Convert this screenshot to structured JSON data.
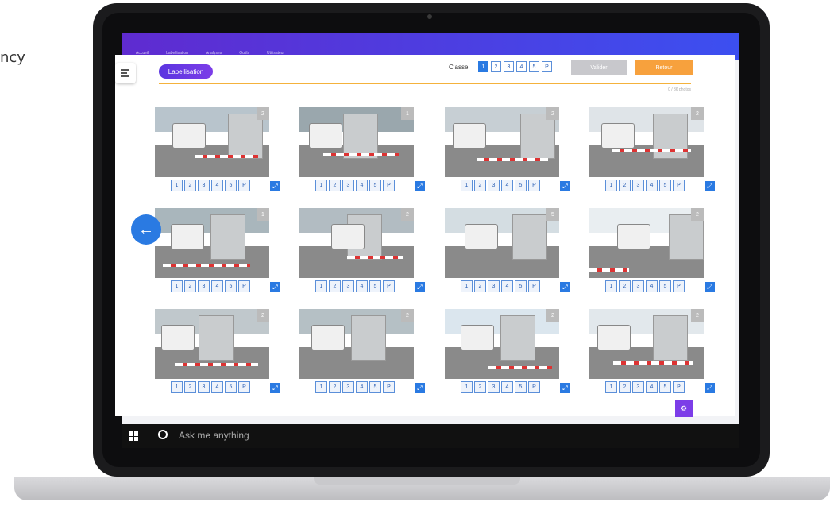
{
  "background_text": "ncy",
  "top_nav": [
    "Accueil",
    "Labellisation",
    "Analyses",
    "Outils",
    "Utilisateur"
  ],
  "taskbar": {
    "search_placeholder": "Ask me anything"
  },
  "app": {
    "title": "Labellisation",
    "classe_label": "Classe:",
    "classe_options": [
      "1",
      "2",
      "3",
      "4",
      "5",
      "P"
    ],
    "classe_selected": "1",
    "valider_label": "Valider",
    "retour_label": "Retour",
    "counter": "0 / 36 photos"
  },
  "photo_class_options": [
    "1",
    "2",
    "3",
    "4",
    "5",
    "P"
  ],
  "photos": [
    {
      "tag": "2"
    },
    {
      "tag": "1"
    },
    {
      "tag": "2"
    },
    {
      "tag": "2"
    },
    {
      "tag": "1"
    },
    {
      "tag": "2"
    },
    {
      "tag": "5"
    },
    {
      "tag": "2"
    },
    {
      "tag": "2"
    },
    {
      "tag": "2"
    },
    {
      "tag": "2"
    },
    {
      "tag": "2"
    }
  ],
  "colors": {
    "accent": "#2a7ae2",
    "purple": "#6a35e0",
    "orange": "#f7a13d",
    "progress": "#f4b23c"
  }
}
